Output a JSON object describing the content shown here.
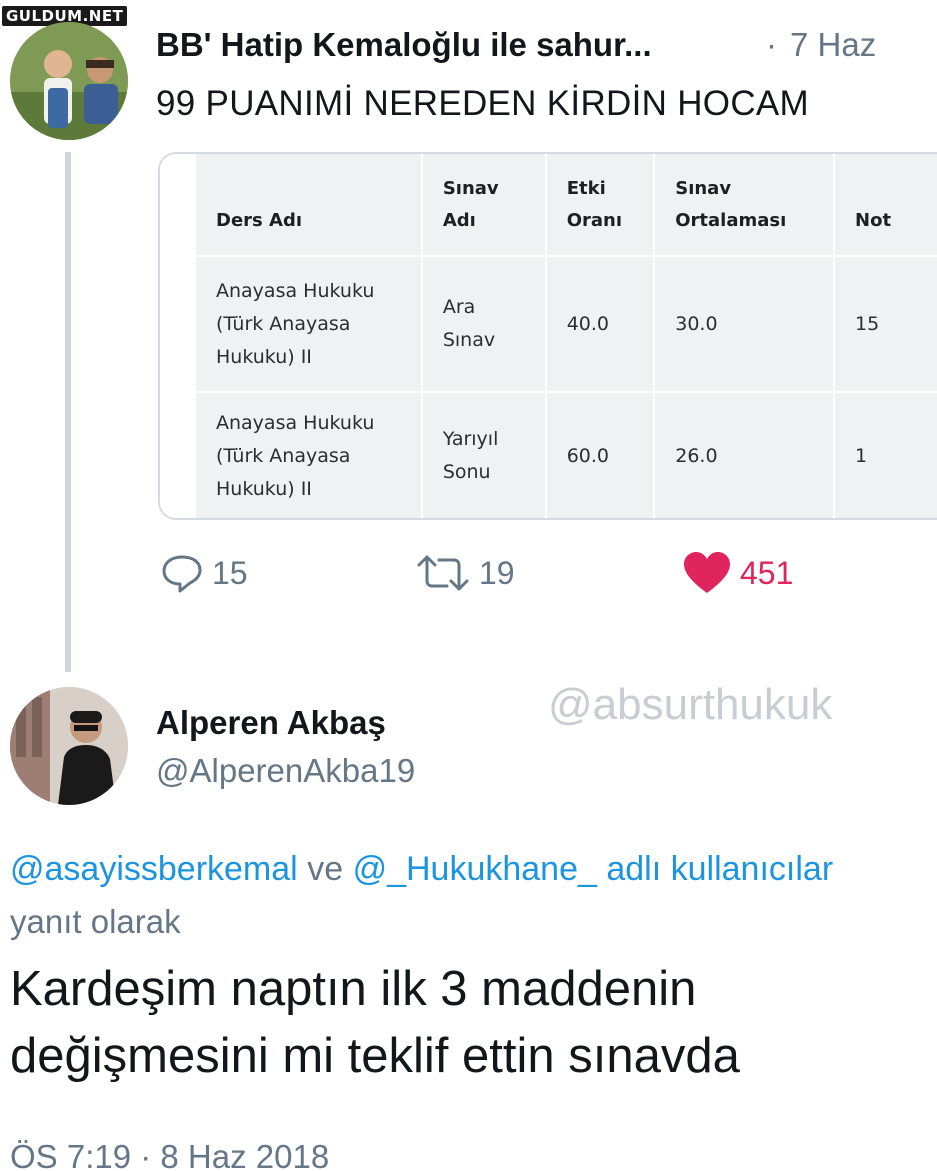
{
  "watermarks": {
    "site": "GULDUM.NET",
    "account": "@absurthukuk"
  },
  "tweet1": {
    "name": "BB' Hatip Kemaloğlu ile sahur...",
    "separator": "·",
    "date": "7 Haz",
    "text": "99 PUANIMİ NEREDEN KİRDİN HOCAM",
    "grade_table": {
      "headers": [
        [
          "Ders Adı"
        ],
        [
          "Sınav",
          "Adı"
        ],
        [
          "Etki",
          "Oranı"
        ],
        [
          "Sınav",
          "Ortalaması"
        ],
        [
          "Not"
        ]
      ],
      "rows": [
        {
          "course": [
            "Anayasa Hukuku",
            "(Türk Anayasa",
            "Hukuku) II"
          ],
          "exam": [
            "Ara",
            "Sınav"
          ],
          "weight": "40.0",
          "average": "30.0",
          "grade": "15"
        },
        {
          "course": [
            "Anayasa Hukuku",
            "(Türk Anayasa",
            "Hukuku) II"
          ],
          "exam": [
            "Yarıyıl",
            "Sonu"
          ],
          "weight": "60.0",
          "average": "26.0",
          "grade": "1"
        }
      ]
    },
    "actions": {
      "replies": "15",
      "retweets": "19",
      "likes": "451"
    },
    "colors": {
      "like": "#e0245e",
      "muted": "#657786"
    }
  },
  "tweet2": {
    "name": "Alperen Akbaş",
    "handle": "@AlperenAkba19",
    "reply_to": {
      "mention1": "@asayissberkemal",
      "connector": "ve",
      "mention2": "@_Hukukhane_",
      "suffix": "adlı kullanıcılar",
      "line2": "yanıt olarak"
    },
    "text_lines": [
      "Kardeşim naptın ilk 3 maddenin",
      "değişmesini mi teklif ettin sınavda"
    ],
    "meta": "ÖS 7:19 · 8 Haz 2018",
    "colors": {
      "mention": "#1b95e0"
    }
  }
}
